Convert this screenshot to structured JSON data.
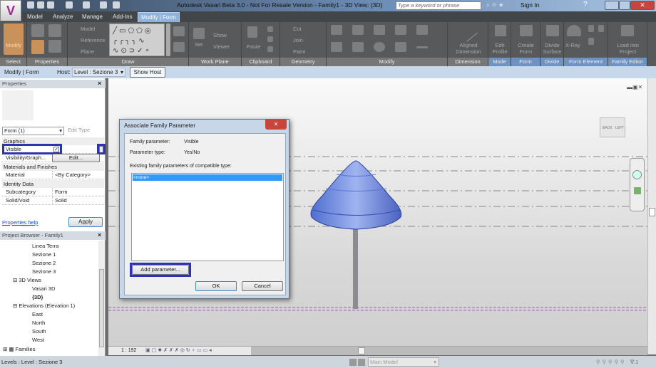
{
  "app": {
    "title": "Autodesk Vasari Beta 3.0 - Not For Resale Version -    Family1 - 3D View: {3D}",
    "search_placeholder": "Type a keyword or phrase",
    "sign_in": "Sign In",
    "logo": "V"
  },
  "tabs": [
    {
      "label": "Model"
    },
    {
      "label": "Analyze"
    },
    {
      "label": "Manage"
    },
    {
      "label": "Add-Ins"
    },
    {
      "label": "Modify | Form",
      "active": true
    }
  ],
  "ribbon": {
    "panels": [
      "Select",
      "Properties",
      "Draw",
      "Work Plane",
      "Clipboard",
      "Geometry",
      "Modify",
      "Dimension",
      "Mode",
      "Form",
      "Divide",
      "Form Element",
      "Family Editor"
    ],
    "buttons": {
      "modify": "Modify",
      "model": "Model",
      "reference": "Reference",
      "plane": "Plane",
      "set": "Set",
      "show": "Show",
      "viewer": "Viewer",
      "paste": "Paste",
      "cut": "Cut",
      "join": "Join",
      "paint": "Paint",
      "aligned_dimension": "Aligned Dimension",
      "edit_profile": "Edit Profile",
      "create_form": "Create Form",
      "divide_surface": "Divide Surface",
      "xray": "X-Ray",
      "load_into_project": "Load into Project"
    }
  },
  "options_bar": {
    "context": "Modify | Form",
    "host_label": "Host:",
    "host_value": "Level : Sezione 3",
    "show_host": "Show Host"
  },
  "properties": {
    "title": "Properties",
    "type_selector": "Form (1)",
    "edit_type": "Edit Type",
    "groups": [
      {
        "name": "Graphics",
        "rows": [
          {
            "key": "Visible",
            "value": "checked"
          },
          {
            "key": "Visibility/Graph...",
            "value": "Edit..."
          }
        ]
      },
      {
        "name": "Materials and Finishes",
        "rows": [
          {
            "key": "Material",
            "value": "<By Category>"
          }
        ]
      },
      {
        "name": "Identity Data",
        "rows": [
          {
            "key": "Subcategory",
            "value": "Form"
          },
          {
            "key": "Solid/Void",
            "value": "Solid"
          }
        ]
      }
    ],
    "help": "Properties help",
    "apply": "Apply"
  },
  "browser": {
    "title": "Project Browser - Family1",
    "items": [
      "Linea Terra",
      "Sezione 1",
      "Sezione 2",
      "Sezione 3",
      "3D Views",
      "Vasari 3D",
      "{3D}",
      "Elevations (Elevation 1)",
      "East",
      "North",
      "South",
      "West",
      "Families"
    ]
  },
  "viewcube": {
    "back": "BACK",
    "left": "LEFT"
  },
  "view_control": {
    "scale": "1 : 192"
  },
  "status": {
    "text": "Levels : Level : Sezione 3",
    "model": "Main Model",
    "filter_count": ":1"
  },
  "dialog": {
    "title": "Associate Family Parameter",
    "family_parameter_label": "Family parameter:",
    "family_parameter_value": "Visible",
    "parameter_type_label": "Parameter type:",
    "parameter_type_value": "Yes/No",
    "list_label": "Existing family parameters of compatible type:",
    "list_items": [
      "<none>"
    ],
    "add_parameter": "Add parameter...",
    "ok": "OK",
    "cancel": "Cancel"
  },
  "colors": {
    "highlight": "#2a34b4",
    "selection": "#3399ff",
    "form": "#6f8fe0",
    "ribbon": "#58595b"
  }
}
